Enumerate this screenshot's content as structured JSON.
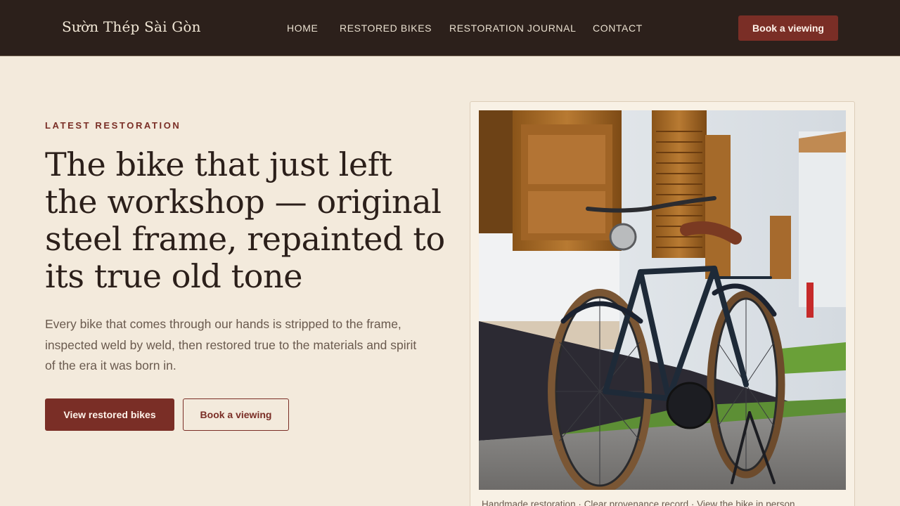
{
  "header": {
    "brand": "Sườn Thép Sài Gòn",
    "nav": [
      "HOME",
      "RESTORED BIKES",
      "RESTORATION JOURNAL",
      "CONTACT"
    ],
    "cta_label": "Book a viewing"
  },
  "hero": {
    "eyebrow": "LATEST RESTORATION",
    "headline": "The bike that just left the workshop — original steel frame, repainted to its true old tone",
    "lede": "Every bike that comes through our hands is stripped to the frame, inspected weld by weld, then restored true to the materials and spirit of the era it was born in.",
    "primary_button": "View restored bikes",
    "secondary_button": "Book a viewing"
  },
  "photo": {
    "caption": "Handmade restoration · Clear provenance record · View the bike in person"
  },
  "colors": {
    "header_bg": "#2c201b",
    "page_bg": "#f3eadc",
    "accent": "#7a2e26"
  }
}
